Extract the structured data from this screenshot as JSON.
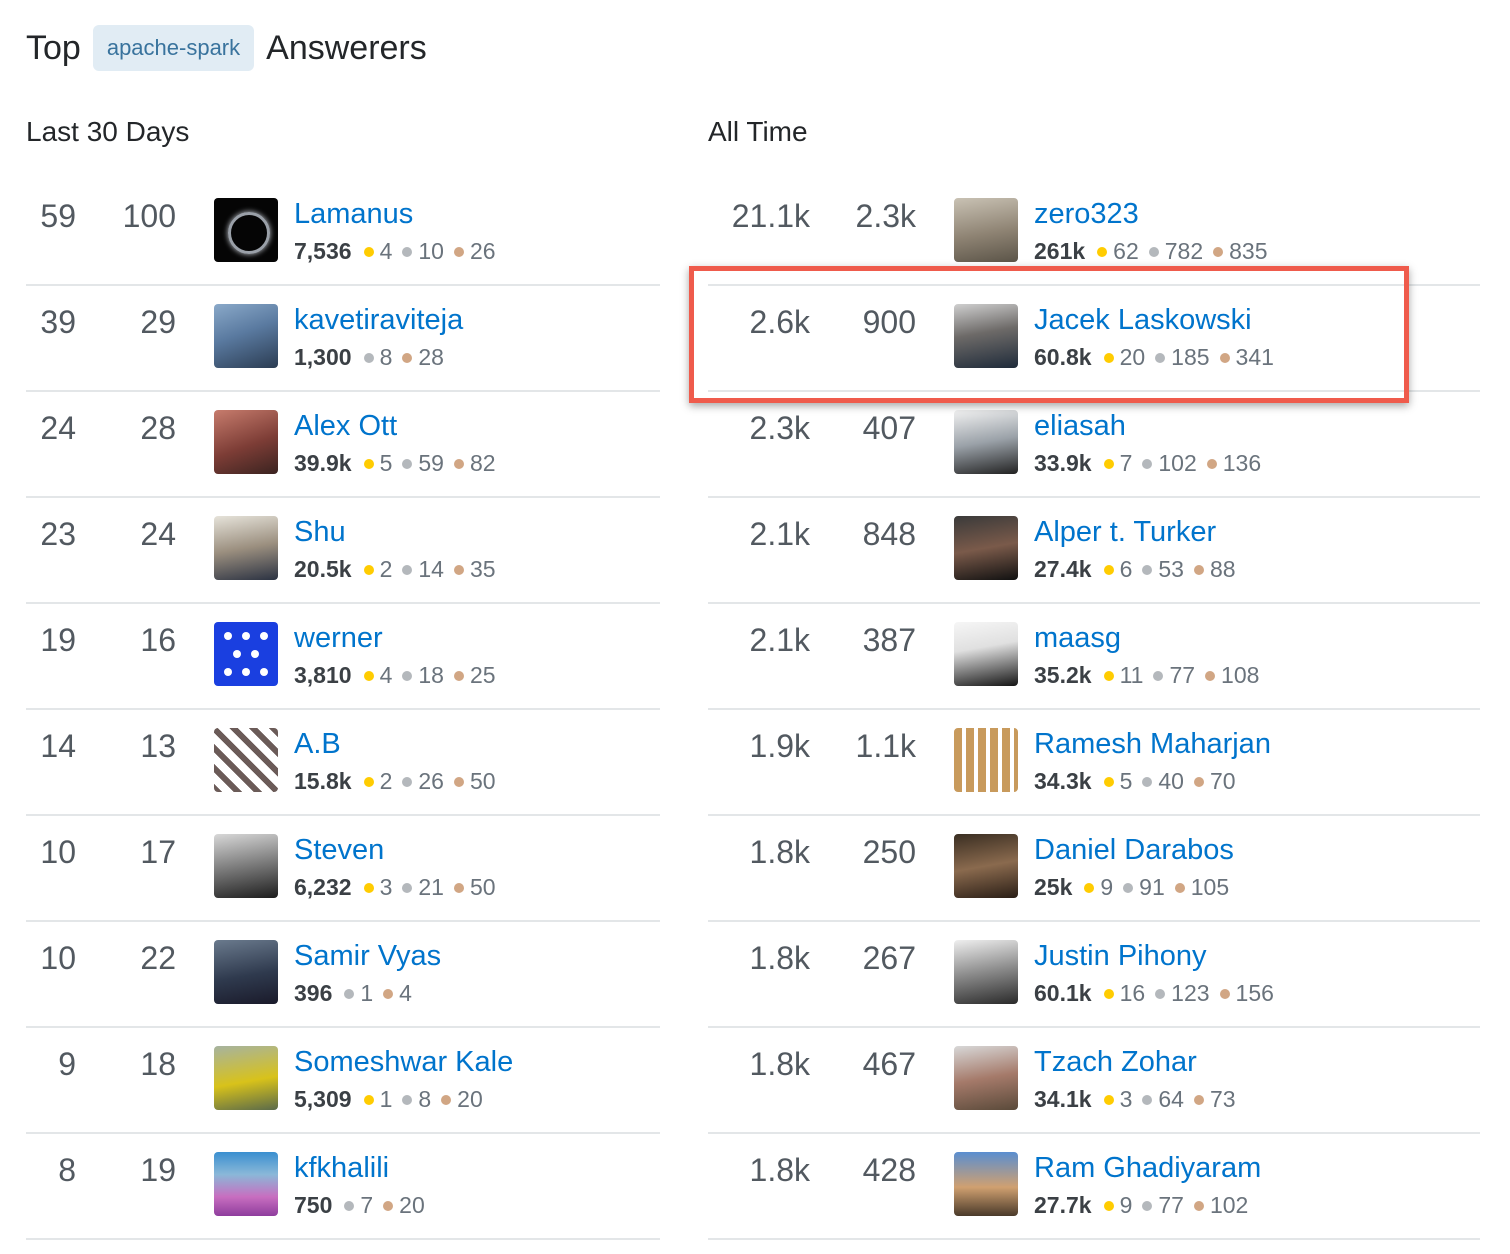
{
  "heading": {
    "prefix": "Top",
    "tag": "apache-spark",
    "suffix": "Answerers"
  },
  "last30": {
    "title": "Last 30 Days",
    "rows": [
      {
        "score": "59",
        "answers": "100",
        "name": "Lamanus",
        "rep": "7,536",
        "gold": "4",
        "silver": "10",
        "bronze": "26",
        "avatar": "eclipse"
      },
      {
        "score": "39",
        "answers": "29",
        "name": "kavetiraviteja",
        "rep": "1,300",
        "gold": "",
        "silver": "8",
        "bronze": "28",
        "avatar": "photo"
      },
      {
        "score": "24",
        "answers": "28",
        "name": "Alex Ott",
        "rep": "39.9k",
        "gold": "5",
        "silver": "59",
        "bronze": "82",
        "avatar": "photo"
      },
      {
        "score": "23",
        "answers": "24",
        "name": "Shu",
        "rep": "20.5k",
        "gold": "2",
        "silver": "14",
        "bronze": "35",
        "avatar": "photo"
      },
      {
        "score": "19",
        "answers": "16",
        "name": "werner",
        "rep": "3,810",
        "gold": "4",
        "silver": "18",
        "bronze": "25",
        "avatar": "identicon"
      },
      {
        "score": "14",
        "answers": "13",
        "name": "A.B",
        "rep": "15.8k",
        "gold": "2",
        "silver": "26",
        "bronze": "50",
        "avatar": "identicon"
      },
      {
        "score": "10",
        "answers": "17",
        "name": "Steven",
        "rep": "6,232",
        "gold": "3",
        "silver": "21",
        "bronze": "50",
        "avatar": "photo"
      },
      {
        "score": "10",
        "answers": "22",
        "name": "Samir Vyas",
        "rep": "396",
        "gold": "",
        "silver": "1",
        "bronze": "4",
        "avatar": "photo"
      },
      {
        "score": "9",
        "answers": "18",
        "name": "Someshwar Kale",
        "rep": "5,309",
        "gold": "1",
        "silver": "8",
        "bronze": "20",
        "avatar": "photo"
      },
      {
        "score": "8",
        "answers": "19",
        "name": "kfkhalili",
        "rep": "750",
        "gold": "",
        "silver": "7",
        "bronze": "20",
        "avatar": "photo"
      }
    ]
  },
  "alltime": {
    "title": "All Time",
    "rows": [
      {
        "score": "21.1k",
        "answers": "2.3k",
        "name": "zero323",
        "rep": "261k",
        "gold": "62",
        "silver": "782",
        "bronze": "835",
        "avatar": "photo"
      },
      {
        "score": "2.6k",
        "answers": "900",
        "name": "Jacek Laskowski",
        "rep": "60.8k",
        "gold": "20",
        "silver": "185",
        "bronze": "341",
        "avatar": "photo"
      },
      {
        "score": "2.3k",
        "answers": "407",
        "name": "eliasah",
        "rep": "33.9k",
        "gold": "7",
        "silver": "102",
        "bronze": "136",
        "avatar": "photo"
      },
      {
        "score": "2.1k",
        "answers": "848",
        "name": "Alper t. Turker",
        "rep": "27.4k",
        "gold": "6",
        "silver": "53",
        "bronze": "88",
        "avatar": "photo"
      },
      {
        "score": "2.1k",
        "answers": "387",
        "name": "maasg",
        "rep": "35.2k",
        "gold": "11",
        "silver": "77",
        "bronze": "108",
        "avatar": "photo"
      },
      {
        "score": "1.9k",
        "answers": "1.1k",
        "name": "Ramesh Maharjan",
        "rep": "34.3k",
        "gold": "5",
        "silver": "40",
        "bronze": "70",
        "avatar": "identicon"
      },
      {
        "score": "1.8k",
        "answers": "250",
        "name": "Daniel Darabos",
        "rep": "25k",
        "gold": "9",
        "silver": "91",
        "bronze": "105",
        "avatar": "photo"
      },
      {
        "score": "1.8k",
        "answers": "267",
        "name": "Justin Pihony",
        "rep": "60.1k",
        "gold": "16",
        "silver": "123",
        "bronze": "156",
        "avatar": "photo"
      },
      {
        "score": "1.8k",
        "answers": "467",
        "name": "Tzach Zohar",
        "rep": "34.1k",
        "gold": "3",
        "silver": "64",
        "bronze": "73",
        "avatar": "photo"
      },
      {
        "score": "1.8k",
        "answers": "428",
        "name": "Ram Ghadiyaram",
        "rep": "27.7k",
        "gold": "9",
        "silver": "77",
        "bronze": "102",
        "avatar": "photo"
      }
    ]
  },
  "colors": {
    "link": "#0074cc",
    "gold": "#ffcc01",
    "silver": "#b4b8bc",
    "bronze": "#d1a684",
    "highlight": "#ef5b4c",
    "tag_bg": "#e1ecf4",
    "tag_text": "#39739d"
  }
}
